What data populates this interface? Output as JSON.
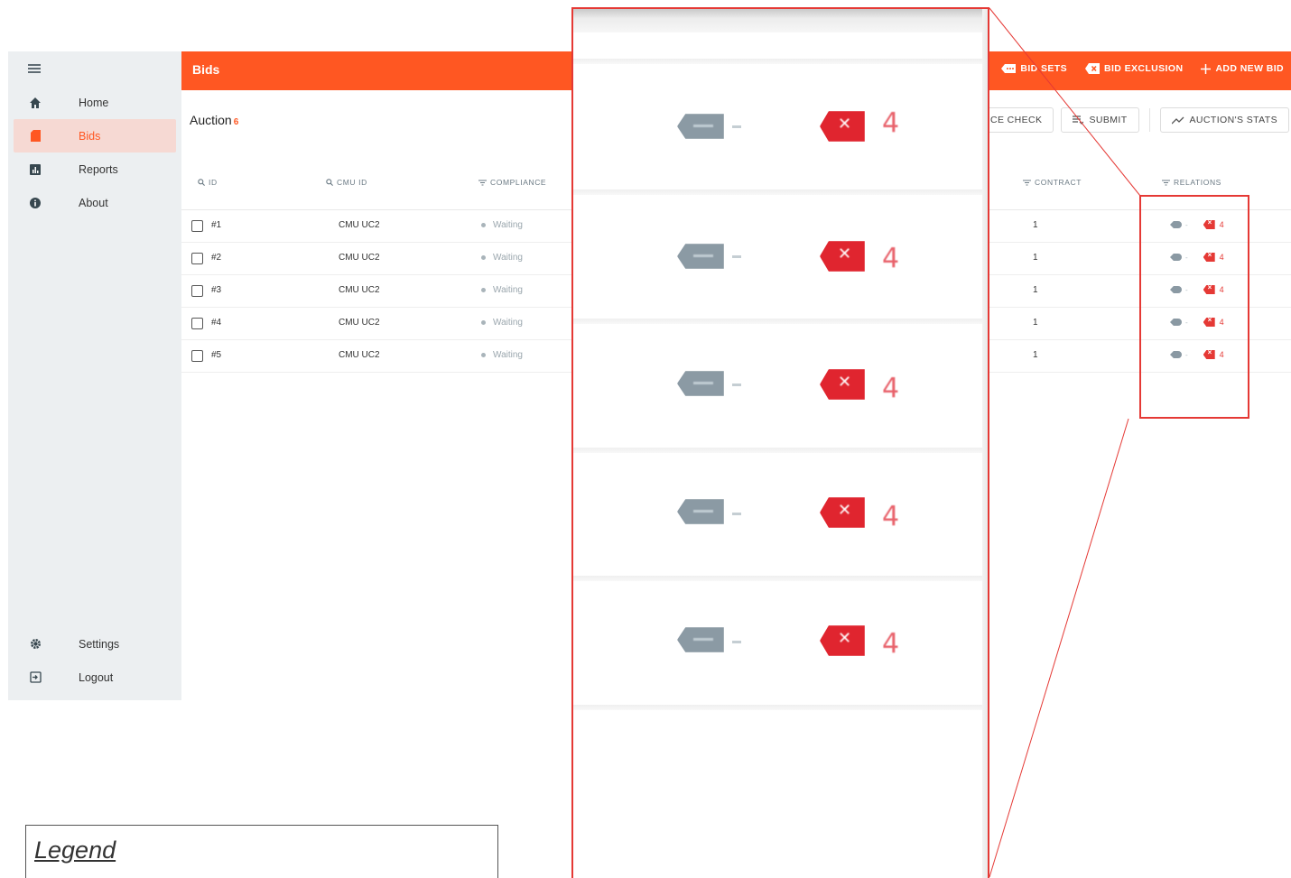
{
  "sidebar": {
    "menu_icon": "hamburger-menu-icon",
    "items": [
      {
        "label": "Home",
        "icon": "home-icon",
        "active": false
      },
      {
        "label": "Bids",
        "icon": "bids-icon",
        "active": true
      },
      {
        "label": "Reports",
        "icon": "bar-chart-icon",
        "active": false
      },
      {
        "label": "About",
        "icon": "info-icon",
        "active": false
      }
    ],
    "bottom_items": [
      {
        "label": "Settings",
        "icon": "gear-icon"
      },
      {
        "label": "Logout",
        "icon": "logout-icon"
      }
    ]
  },
  "header": {
    "title": "Bids",
    "actions": [
      {
        "label": "BID SETS",
        "icon": "bid-sets-icon"
      },
      {
        "label": "BID EXCLUSION",
        "icon": "exclusion-icon"
      },
      {
        "label": "ADD NEW BID",
        "icon": "plus-icon"
      }
    ]
  },
  "toolbar": {
    "title": "Auction",
    "count": "6",
    "buttons": [
      {
        "label": "NCE CHECK",
        "icon": ""
      },
      {
        "label": "SUBMIT",
        "icon": "submit-list-icon"
      },
      {
        "label": "AUCTION'S STATS",
        "icon": "trend-line-icon"
      }
    ]
  },
  "table": {
    "columns": [
      {
        "label": "ID",
        "icon": "search-icon"
      },
      {
        "label": "CMU ID",
        "icon": "search-icon"
      },
      {
        "label": "COMPLIANCE",
        "icon": "filter-icon"
      },
      {
        "label": "CONTRACT",
        "icon": "filter-icon"
      },
      {
        "label": "RELATIONS",
        "icon": "filter-icon"
      }
    ],
    "rows": [
      {
        "id": "#1",
        "cmu_id": "CMU UC2",
        "compliance": "Waiting",
        "contract": "1",
        "relations_count": "4"
      },
      {
        "id": "#2",
        "cmu_id": "CMU UC2",
        "compliance": "Waiting",
        "contract": "1",
        "relations_count": "4"
      },
      {
        "id": "#3",
        "cmu_id": "CMU UC2",
        "compliance": "Waiting",
        "contract": "1",
        "relations_count": "4"
      },
      {
        "id": "#4",
        "cmu_id": "CMU UC2",
        "compliance": "Waiting",
        "contract": "1",
        "relations_count": "4"
      },
      {
        "id": "#5",
        "cmu_id": "CMU UC2",
        "compliance": "Waiting",
        "contract": "1",
        "relations_count": "4"
      }
    ]
  },
  "zoom": {
    "rows": [
      {
        "count": "4"
      },
      {
        "count": "4"
      },
      {
        "count": "4"
      },
      {
        "count": "4"
      },
      {
        "count": "4"
      }
    ]
  },
  "legend": {
    "title": "Legend"
  },
  "colors": {
    "accent": "#ff5722",
    "highlight": "#e53935",
    "sidebar_bg": "#eceff1"
  }
}
